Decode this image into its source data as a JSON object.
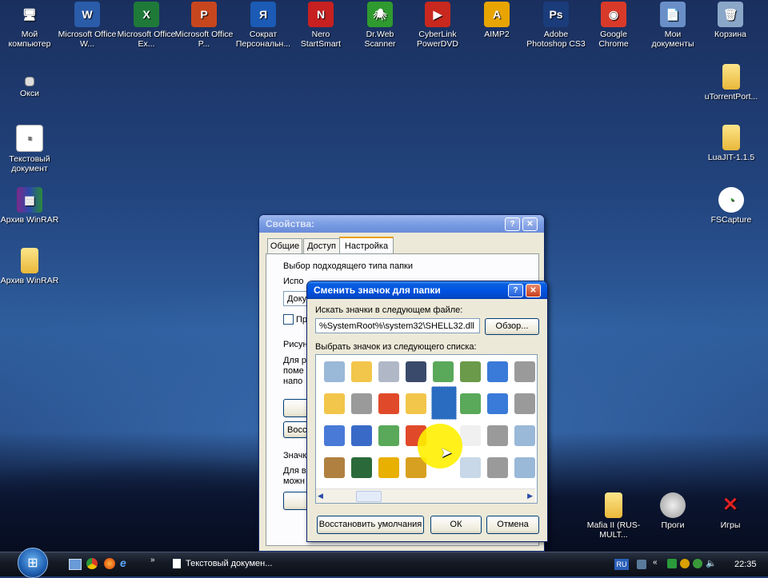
{
  "desktop_icons_top": [
    {
      "label": "Мой компьютер",
      "icon": "my-computer-icon",
      "glyph": "🖥"
    },
    {
      "label": "Microsoft Office W...",
      "icon": "word-icon",
      "glyph": "W",
      "color": "#2a5caa"
    },
    {
      "label": "Microsoft Office Ex...",
      "icon": "excel-icon",
      "glyph": "X",
      "color": "#1f7a3a"
    },
    {
      "label": "Microsoft Office P...",
      "icon": "powerpoint-icon",
      "glyph": "P",
      "color": "#c8461e"
    },
    {
      "label": "Сократ Персональн...",
      "icon": "socrat-icon",
      "glyph": "Я",
      "color": "#1b5bb5"
    },
    {
      "label": "Nero StartSmart",
      "icon": "nero-icon",
      "glyph": "N",
      "color": "#c62020"
    },
    {
      "label": "Dr.Web Scanner",
      "icon": "drweb-icon",
      "glyph": "🕷",
      "color": "#2f9a2f"
    },
    {
      "label": "CyberLink PowerDVD",
      "icon": "powerdvd-icon",
      "glyph": "▶",
      "color": "#c8281e"
    },
    {
      "label": "AIMP2",
      "icon": "aimp-icon",
      "glyph": "A",
      "color": "#e8a400"
    },
    {
      "label": "Adobe Photoshop CS3",
      "icon": "photoshop-icon",
      "glyph": "Ps",
      "color": "#1a3c7a"
    },
    {
      "label": "Google Chrome",
      "icon": "chrome-icon",
      "glyph": "◉",
      "color": "#d83a2a"
    },
    {
      "label": "Мои документы",
      "icon": "my-documents-icon",
      "glyph": "📄",
      "color": "#6a8fc8"
    },
    {
      "label": "Корзина",
      "icon": "recycle-bin-icon",
      "glyph": "🗑",
      "color": "#8aa6c8"
    }
  ],
  "desktop_icons_left": [
    {
      "label": "Окси",
      "icon": "oksi-icon"
    },
    {
      "label": "Текстовый документ",
      "icon": "text-document-icon"
    },
    {
      "label": "Архив WinRAR",
      "icon": "winrar-icon"
    },
    {
      "label": "Архив WinRAR",
      "icon": "folder-icon"
    }
  ],
  "desktop_icons_right": [
    {
      "label": "uTorrentPort...",
      "icon": "folder-icon"
    },
    {
      "label": "LuaJIT-1.1.5",
      "icon": "folder-icon"
    },
    {
      "label": "FSCapture",
      "icon": "fscapture-icon"
    }
  ],
  "desktop_icons_bottom": [
    {
      "label": "Mafia II (RUS-MULT...",
      "icon": "folder-icon"
    },
    {
      "label": "Проги",
      "icon": "programs-icon"
    },
    {
      "label": "Игры",
      "icon": "games-icon"
    }
  ],
  "properties_window": {
    "title": "Свойства:",
    "tabs": [
      "Общие",
      "Доступ",
      "Настройка"
    ],
    "active_tab": "Настройка",
    "group1": "Выбор подходящего типа папки",
    "use_label": "Испо",
    "dropdown_value": "Доку",
    "checkbox_label": "Пр",
    "group2": "Рисун",
    "group2_text": [
      "Для р",
      "поме",
      "напо"
    ],
    "button_partial": "Восс",
    "group3": "Значк",
    "group3_text": [
      "Для в",
      "можн"
    ]
  },
  "change_icon_dialog": {
    "title": "Сменить значок для папки",
    "search_label": "Искать значки в следующем файле:",
    "file_path": "%SystemRoot%\\system32\\SHELL32.dll",
    "browse_button": "Обзор...",
    "list_label": "Выбрать значок из следующего списка:",
    "restore_button": "Восстановить умолчания",
    "ok_button": "ОК",
    "cancel_button": "Отмена",
    "icon_grid": [
      [
        "recycle-bin-full-icon",
        "folder-doc-icon",
        "cd-drive-icon",
        "lock-icon",
        "network-pc-icon",
        "users-icon",
        "monitor-icon",
        "printer-icon"
      ],
      [
        "folder-person-icon",
        "printer-folder-icon",
        "windows-flag-icon",
        "folder-search-icon",
        "selected-blank-icon",
        "network-drive-icon",
        "monitor-settings-icon",
        "printer-disk-icon"
      ],
      [
        "laptop-icon",
        "font-folder-icon",
        "network-share-icon",
        "windows-globe-icon",
        "blank-icon",
        "paper-icon",
        "printer-network-icon",
        "recycle-bin-empty-icon"
      ],
      [
        "tools-folder-icon",
        "display-app-icon",
        "star-folder-icon",
        "padlock-icon",
        "blank-icon",
        "search-doc-icon",
        "printer-list-icon",
        "recycle-bin-icon"
      ]
    ]
  },
  "taskbar": {
    "task_label": "Текстовый докумен...",
    "language": "RU",
    "clock": "22:35"
  }
}
